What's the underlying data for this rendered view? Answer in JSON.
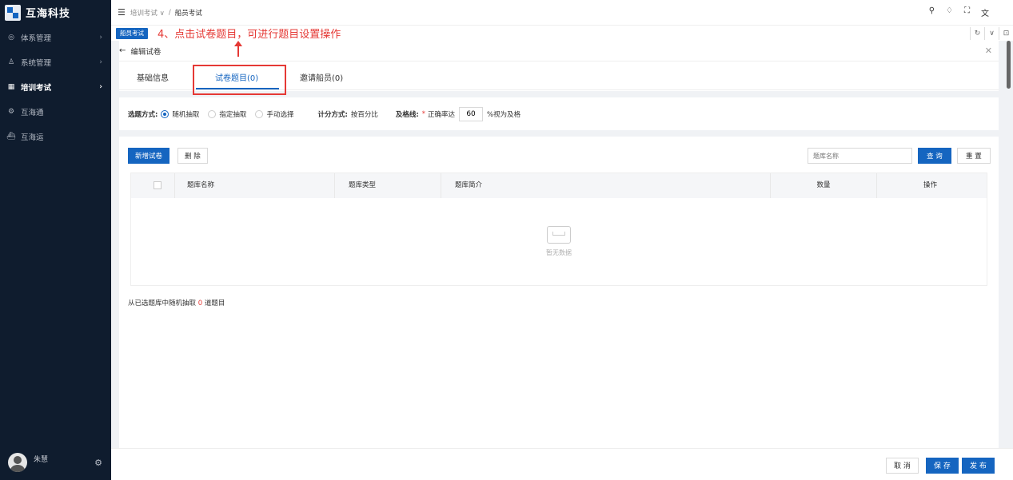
{
  "app": {
    "logo_text": "互海科技"
  },
  "sidebar": {
    "items": [
      {
        "label": "体系管理",
        "icon": "system-circle-icon",
        "active": false
      },
      {
        "label": "系统管理",
        "icon": "user-cog-icon",
        "active": false
      },
      {
        "label": "培训考试",
        "icon": "grid-icon",
        "active": true
      },
      {
        "label": "互海通",
        "icon": "gear-icon",
        "active": false
      },
      {
        "label": "互海运",
        "icon": "ship-icon",
        "active": false
      }
    ],
    "user_name": "朱慧"
  },
  "topbar": {
    "breadcrumb": [
      {
        "label": "培训考试 ∨"
      },
      {
        "label": "船员考试"
      }
    ],
    "separator": "/"
  },
  "tagrow": {
    "active_tag": "船员考试",
    "annotation": "4、点击试卷题目，可进行题目设置操作"
  },
  "panel": {
    "title": "编辑试卷",
    "tabs": [
      {
        "label": "基础信息"
      },
      {
        "label": "试卷题目(0)"
      },
      {
        "label": "邀请船员(0)"
      }
    ],
    "settings": {
      "select_mode_label": "选题方式:",
      "select_options": [
        "随机抽取",
        "指定抽取",
        "手动选择"
      ],
      "score_mode_label": "计分方式:",
      "score_mode_value": "按百分比",
      "pass_label": "及格线:",
      "pass_prefix": "正确率达",
      "pass_value": "60",
      "pass_suffix": "%视为及格"
    },
    "toolbar": {
      "add_label": "新增试卷",
      "delete_label": "删 除",
      "search_placeholder": "题库名称",
      "query_label": "查 询",
      "reset_label": "重 置"
    },
    "table": {
      "columns": [
        "题库名称",
        "题库类型",
        "题库简介",
        "数量",
        "操作"
      ],
      "empty_text": "暂无数据"
    },
    "footer": {
      "prefix": "从已选题库中随机抽取",
      "count": "0",
      "suffix": "道题目"
    }
  },
  "bottom": {
    "cancel": "取 消",
    "save": "保 存",
    "publish": "发 布"
  },
  "colors": {
    "accent": "#1565c0",
    "sidebar_bg": "#0f1c2e",
    "annotation": "#e53935"
  }
}
